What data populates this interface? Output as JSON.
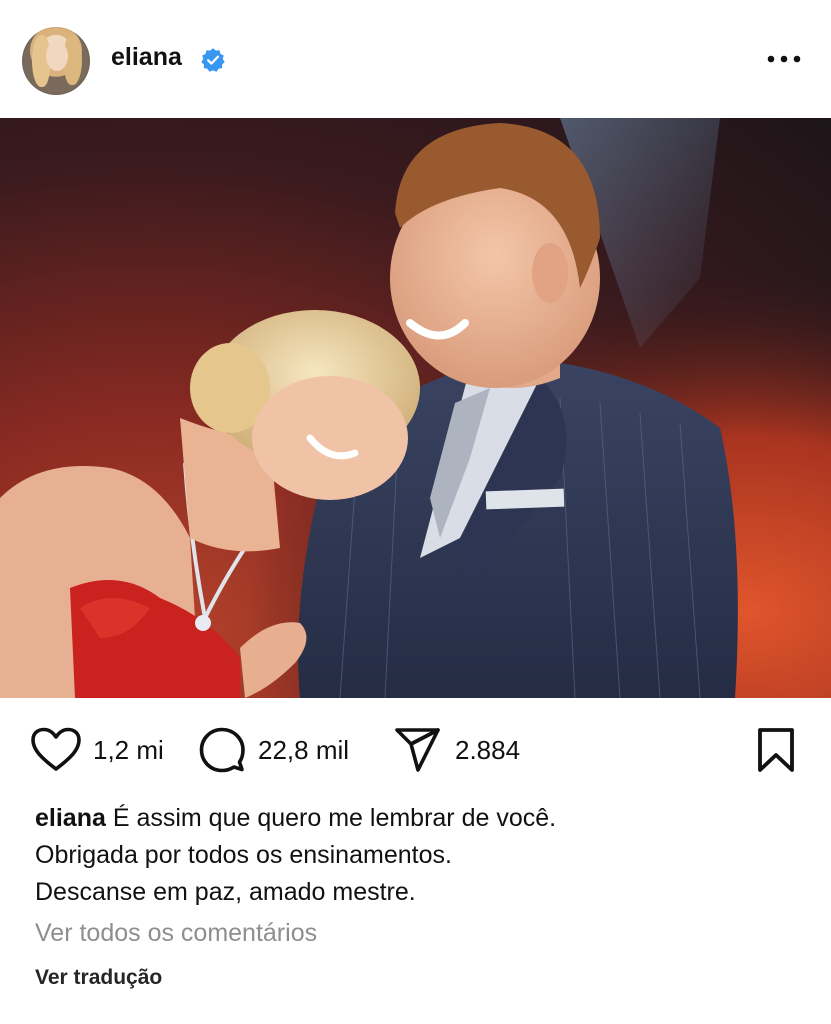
{
  "header": {
    "username": "eliana",
    "verified": true,
    "avatar_icon": "profile-avatar",
    "more_icon": "more-horizontal-icon"
  },
  "post": {
    "image_alt_icon": "post-photo"
  },
  "actions": {
    "likes": "1,2 mi",
    "comments": "22,8 mil",
    "shares": "2.884",
    "icons": {
      "like": "heart-icon",
      "comment": "comment-bubble-icon",
      "share": "send-icon",
      "save": "bookmark-icon"
    }
  },
  "caption": {
    "username": "eliana",
    "line1": "É assim que quero me lembrar de você.",
    "line2": "Obrigada por todos os ensinamentos.",
    "line3": "Descanse em paz, amado mestre."
  },
  "view_comments": "Ver todos os comentários",
  "translate": "Ver tradução",
  "colors": {
    "verified_blue": "#3897f0",
    "muted_text": "#8e8e8e",
    "text": "#111111"
  }
}
